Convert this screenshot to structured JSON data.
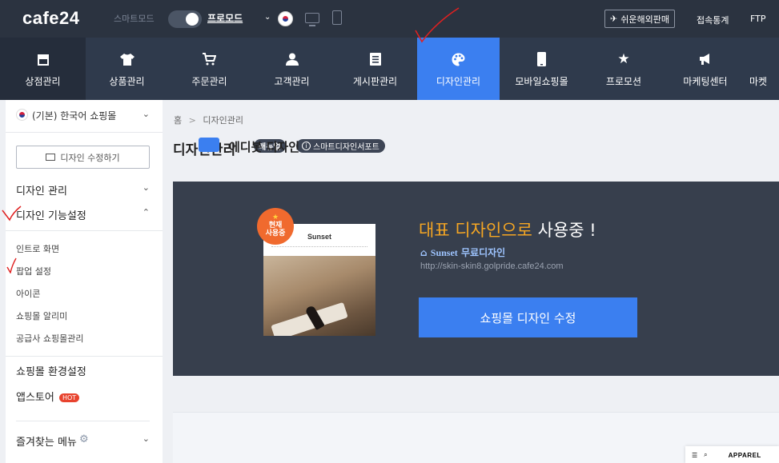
{
  "topbar": {
    "logo": "cafe24",
    "smart_mode_label": "스마트모드",
    "pro_mode_label": "프로모드",
    "mode_caret": "⌄",
    "overseas_button": "쉬운해외판매",
    "stats_link": "접속통계",
    "ftp_link": "FTP"
  },
  "main_nav": [
    {
      "label": "상점관리",
      "icon": "store-icon"
    },
    {
      "label": "상품관리",
      "icon": "shirt-icon"
    },
    {
      "label": "주문관리",
      "icon": "cart-icon"
    },
    {
      "label": "고객관리",
      "icon": "user-icon"
    },
    {
      "label": "게시판관리",
      "icon": "board-icon"
    },
    {
      "label": "디자인관리",
      "icon": "palette-icon",
      "active": true
    },
    {
      "label": "모바일쇼핑몰",
      "icon": "mobile-icon"
    },
    {
      "label": "프로모션",
      "icon": "star-icon"
    },
    {
      "label": "마케팅센터",
      "icon": "megaphone-icon"
    },
    {
      "label": "마켓",
      "icon": "market-icon"
    }
  ],
  "sidebar": {
    "mall_selector": "(기본) 한국어 쇼핑몰",
    "edit_design_button": "디자인 수정하기",
    "design_manage": "디자인 관리",
    "design_feature_settings": "디자인 기능설정",
    "sub_items": [
      "인트로 화면",
      "팝업 설정",
      "아이콘",
      "쇼핑몰 알리미",
      "공급사 쇼핑몰관리"
    ],
    "mall_env_settings": "쇼핑몰 환경설정",
    "app_store": "앱스토어",
    "hot_badge": "HOT",
    "favorites": "즐겨찾는 메뉴"
  },
  "content": {
    "breadcrumb_home": "홈",
    "breadcrumb_sep": ">",
    "breadcrumb_current": "디자인관리",
    "page_title": "디자인관리",
    "manual_badge": "매뉴얼",
    "support_badge": "스마트디자인서포트",
    "hero": {
      "title_highlight": "대표 디자인으로",
      "title_rest": " 사용중 !",
      "now_badge_line1": "현재",
      "now_badge_line2": "사용중",
      "thumb_brand": "Sunset",
      "design_name": "Sunset",
      "design_type": "무료디자인",
      "url": "http://skin-skin8.golpride.cafe24.com",
      "edit_button": "쇼핑몰 디자인 수정"
    },
    "editor": {
      "title": "에디봇 디자인",
      "preview_label": "APPAREL"
    }
  },
  "colors": {
    "topbar": "#2b3340",
    "nav": "#2f3a4c",
    "active": "#3b7ff0",
    "highlight": "#f5a623",
    "annotation": "#e02020"
  }
}
